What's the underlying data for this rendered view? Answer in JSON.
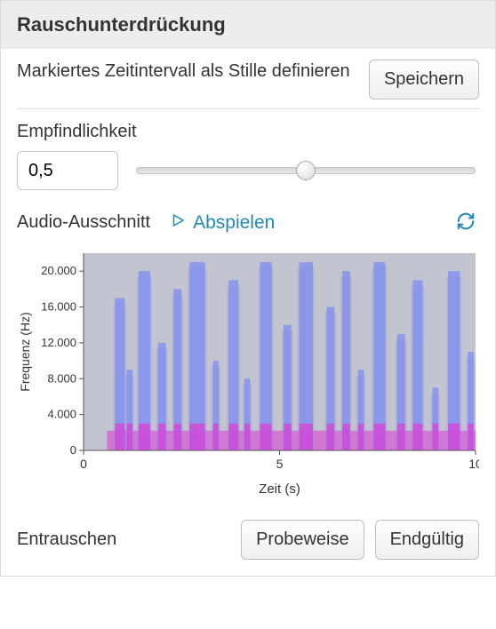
{
  "header": {
    "title": "Rauschunterdrückung"
  },
  "silence": {
    "label": "Markiertes Zeitintervall als Stille definieren",
    "save_label": "Speichern"
  },
  "sensitivity": {
    "label": "Empfindlichkeit",
    "value": "0,5",
    "slider_percent": 50
  },
  "audio": {
    "label": "Audio-Ausschnitt",
    "play_label": "Abspielen"
  },
  "denoise": {
    "label": "Entrauschen",
    "trial_label": "Probeweise",
    "final_label": "Endgültig"
  },
  "colors": {
    "accent": "#1e8ab5",
    "spectro_low": "#c2c4cf",
    "spectro_mid": "#7e8df0",
    "spectro_high": "#e23bd4"
  },
  "chart_data": {
    "type": "heatmap",
    "title": "",
    "xlabel": "Zeit (s)",
    "ylabel": "Frequenz (Hz)",
    "xlim": [
      0,
      10
    ],
    "ylim": [
      0,
      22000
    ],
    "x_ticks": [
      0,
      5,
      10
    ],
    "y_ticks": [
      0,
      4000,
      8000,
      12000,
      16000,
      20000
    ],
    "y_tick_labels": [
      "0",
      "4.000",
      "8.000",
      "12.000",
      "16.000",
      "20.000"
    ],
    "events": [
      {
        "t": 0.8,
        "w": 0.25,
        "fmax": 17000
      },
      {
        "t": 1.1,
        "w": 0.15,
        "fmax": 9000
      },
      {
        "t": 1.4,
        "w": 0.3,
        "fmax": 20000
      },
      {
        "t": 1.9,
        "w": 0.2,
        "fmax": 12000
      },
      {
        "t": 2.3,
        "w": 0.2,
        "fmax": 18000
      },
      {
        "t": 2.7,
        "w": 0.4,
        "fmax": 21000
      },
      {
        "t": 3.3,
        "w": 0.15,
        "fmax": 10000
      },
      {
        "t": 3.7,
        "w": 0.25,
        "fmax": 19000
      },
      {
        "t": 4.1,
        "w": 0.15,
        "fmax": 8000
      },
      {
        "t": 4.5,
        "w": 0.3,
        "fmax": 21000
      },
      {
        "t": 5.1,
        "w": 0.2,
        "fmax": 14000
      },
      {
        "t": 5.5,
        "w": 0.35,
        "fmax": 21000
      },
      {
        "t": 6.2,
        "w": 0.2,
        "fmax": 16000
      },
      {
        "t": 6.6,
        "w": 0.2,
        "fmax": 20000
      },
      {
        "t": 7.0,
        "w": 0.15,
        "fmax": 9000
      },
      {
        "t": 7.4,
        "w": 0.3,
        "fmax": 21000
      },
      {
        "t": 8.0,
        "w": 0.2,
        "fmax": 13000
      },
      {
        "t": 8.4,
        "w": 0.25,
        "fmax": 19000
      },
      {
        "t": 8.9,
        "w": 0.15,
        "fmax": 7000
      },
      {
        "t": 9.3,
        "w": 0.3,
        "fmax": 20000
      },
      {
        "t": 9.8,
        "w": 0.15,
        "fmax": 11000
      }
    ]
  }
}
